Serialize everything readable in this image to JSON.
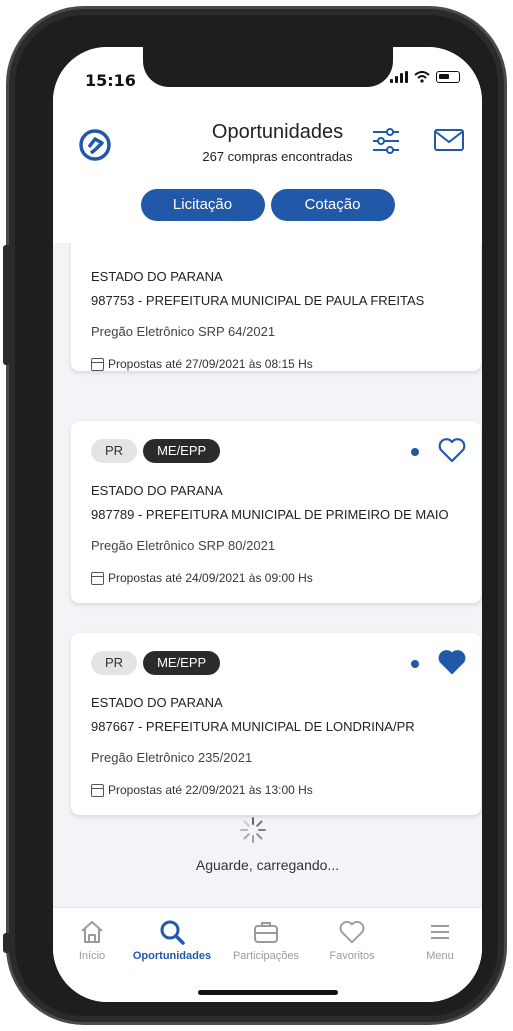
{
  "status": {
    "time": "15:16"
  },
  "header": {
    "title": "Oportunidades",
    "subtitle": "267 compras encontradas",
    "tabs": [
      {
        "label": "Licitação"
      },
      {
        "label": "Cotação"
      }
    ]
  },
  "cards": [
    {
      "uf": "",
      "category": "",
      "entity": "ESTADO DO PARANA",
      "buyer": "987753 - PREFEITURA MUNICIPAL DE PAULA FREITAS",
      "modality": "Pregão Eletrônico SRP 64/2021",
      "deadline": "Propostas até 27/09/2021 às 08:15 Hs",
      "favorited": false
    },
    {
      "uf": "PR",
      "category": "ME/EPP",
      "entity": "ESTADO DO PARANA",
      "buyer": "987789 - PREFEITURA MUNICIPAL DE PRIMEIRO DE MAIO",
      "modality": "Pregão Eletrônico SRP 80/2021",
      "deadline": "Propostas até 24/09/2021 às 09:00 Hs",
      "favorited": false
    },
    {
      "uf": "PR",
      "category": "ME/EPP",
      "entity": "ESTADO DO PARANA",
      "buyer": "987667 - PREFEITURA MUNICIPAL DE LONDRINA/PR",
      "modality": "Pregão Eletrônico 235/2021",
      "deadline": "Propostas até 22/09/2021 às 13:00 Hs",
      "favorited": true
    }
  ],
  "loading_text": "Aguarde, carregando...",
  "tabbar": {
    "items": [
      {
        "label": "Início",
        "icon": "home-icon"
      },
      {
        "label": "Oportunidades",
        "icon": "search-icon",
        "active": true
      },
      {
        "label": "Participações",
        "icon": "briefcase-icon"
      },
      {
        "label": "Favoritos",
        "icon": "heart-icon"
      },
      {
        "label": "Menu",
        "icon": "menu-icon"
      }
    ]
  },
  "colors": {
    "primary": "#2158a8",
    "tag_dark": "#2b2b2b",
    "tag_light": "#e4e4e4",
    "inactive": "#9a9a9a"
  }
}
